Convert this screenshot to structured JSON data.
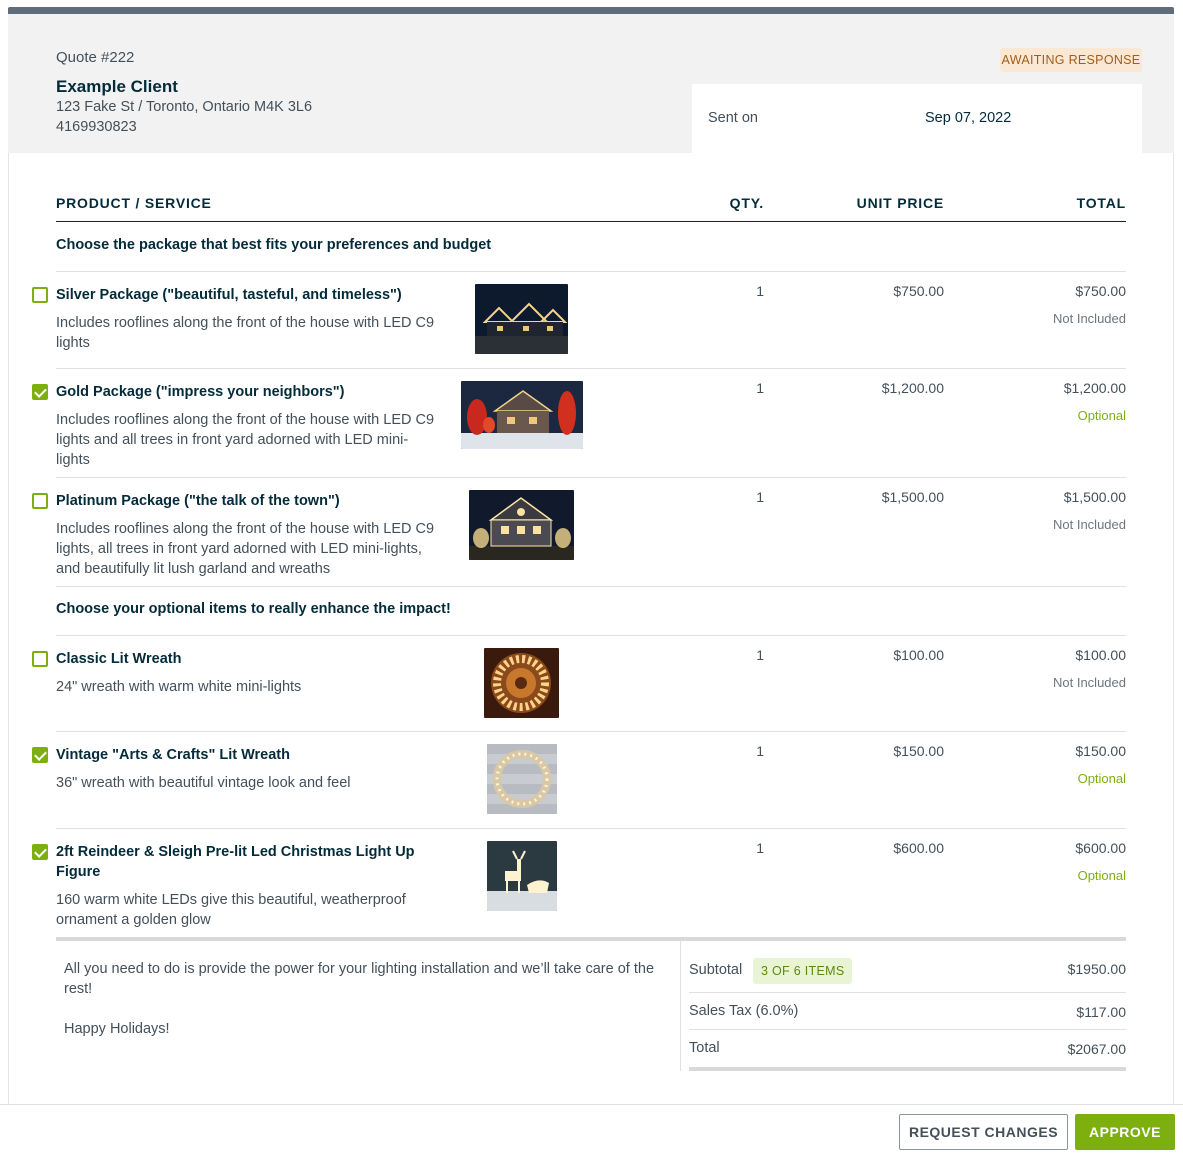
{
  "quote": {
    "number": "Quote #222",
    "client_name": "Example Client",
    "address": "123 Fake St / Toronto, Ontario M4K 3L6",
    "phone": "4169930823",
    "status": "AWAITING RESPONSE",
    "sent_label": "Sent on",
    "sent_date": "Sep 07, 2022"
  },
  "table": {
    "headers": [
      "PRODUCT / SERVICE",
      "QTY.",
      "UNIT PRICE",
      "TOTAL"
    ],
    "section1": "Choose the package that best fits your preferences and budget",
    "section2": "Choose your optional items to really enhance the impact!",
    "items": [
      {
        "checked": false,
        "name": "Silver Package (\"beautiful, tasteful, and timeless\")",
        "desc": "Includes rooflines along the front of the house with LED C9 lights",
        "qty": "1",
        "unit": "$750.00",
        "total": "$750.00",
        "status": "Not Included",
        "image": "house-lights-photo"
      },
      {
        "checked": true,
        "name": "Gold Package (\"impress your neighbors\")",
        "desc": "Includes rooflines along the front of the house with LED C9 lights and all trees in front yard adorned with LED mini-lights",
        "qty": "1",
        "unit": "$1,200.00",
        "total": "$1,200.00",
        "status": "Optional",
        "image": "house-lights-photo"
      },
      {
        "checked": false,
        "name": "Platinum Package (\"the talk of the town\")",
        "desc": "Includes rooflines along the front of the house with LED C9 lights, all trees in front yard adorned with LED mini-lights, and beautifully lit lush garland and wreaths",
        "qty": "1",
        "unit": "$1,500.00",
        "total": "$1,500.00",
        "status": "Not Included",
        "image": "house-lights-photo"
      },
      {
        "checked": false,
        "name": "Classic Lit Wreath",
        "desc": "24\" wreath with warm white mini-lights",
        "qty": "1",
        "unit": "$100.00",
        "total": "$100.00",
        "status": "Not Included",
        "image": "wreath-photo"
      },
      {
        "checked": true,
        "name": "Vintage \"Arts & Crafts\" Lit Wreath",
        "desc": "36\" wreath with beautiful vintage look and feel",
        "qty": "1",
        "unit": "$150.00",
        "total": "$150.00",
        "status": "Optional",
        "image": "wreath-photo"
      },
      {
        "checked": true,
        "name": "2ft Reindeer & Sleigh Pre-lit Led Christmas Light Up Figure",
        "desc": "160 warm white LEDs give this beautiful, weatherproof ornament a golden glow",
        "qty": "1",
        "unit": "$600.00",
        "total": "$600.00",
        "status": "Optional",
        "image": "reindeer-photo"
      }
    ]
  },
  "notes": [
    "All you need to do is provide the power for your lighting installation and we’ll take care of the rest!",
    "Happy Holidays!"
  ],
  "summary": {
    "subtotal_label": "Subtotal",
    "item_count": "3 OF 6 ITEMS",
    "subtotal": "$1950.00",
    "tax_label": "Sales Tax (6.0%)",
    "tax": "$117.00",
    "total_label": "Total",
    "total": "$2067.00"
  },
  "actions": {
    "request_changes": "REQUEST CHANGES",
    "approve": "APPROVE"
  },
  "colors": {
    "accent": "#7db00e",
    "text_dark": "#032b3a",
    "status_badge_bg": "#fbe8d4",
    "status_badge_text": "#a15d1a"
  }
}
